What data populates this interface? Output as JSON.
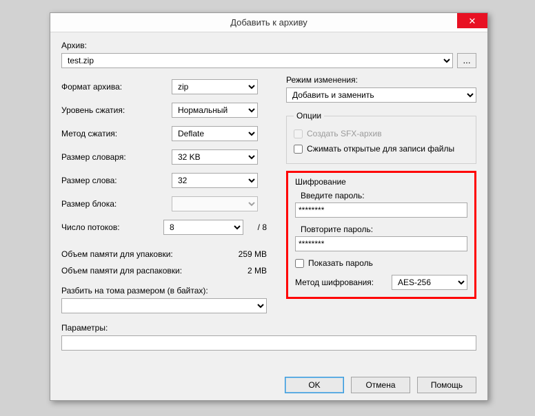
{
  "title": "Добавить к архиву",
  "close_glyph": "✕",
  "archive_label": "Архив:",
  "archive_value": "test.zip",
  "browse_label": "...",
  "left": {
    "format_label": "Формат архива:",
    "format_value": "zip",
    "level_label": "Уровень сжатия:",
    "level_value": "Нормальный",
    "method_label": "Метод сжатия:",
    "method_value": "Deflate",
    "dict_label": "Размер словаря:",
    "dict_value": "32 KB",
    "word_label": "Размер слова:",
    "word_value": "32",
    "block_label": "Размер блока:",
    "block_value": "",
    "threads_label": "Число потоков:",
    "threads_value": "8",
    "threads_max": "/ 8",
    "mem_pack_label": "Объем памяти для упаковки:",
    "mem_pack_value": "259 MB",
    "mem_unpack_label": "Объем памяти для распаковки:",
    "mem_unpack_value": "2 MB",
    "split_label": "Разбить на тома размером (в байтах):",
    "split_value": ""
  },
  "right": {
    "update_label": "Режим изменения:",
    "update_value": "Добавить и заменить",
    "options_legend": "Опции",
    "sfx_label": "Создать SFX-архив",
    "shared_label": "Сжимать открытые для записи файлы",
    "encryption": {
      "legend": "Шифрование",
      "enter_label": "Введите пароль:",
      "enter_value": "********",
      "repeat_label": "Повторите пароль:",
      "repeat_value": "********",
      "show_label": "Показать пароль",
      "method_label": "Метод шифрования:",
      "method_value": "AES-256"
    }
  },
  "params_label": "Параметры:",
  "params_value": "",
  "buttons": {
    "ok": "OK",
    "cancel": "Отмена",
    "help": "Помощь"
  }
}
